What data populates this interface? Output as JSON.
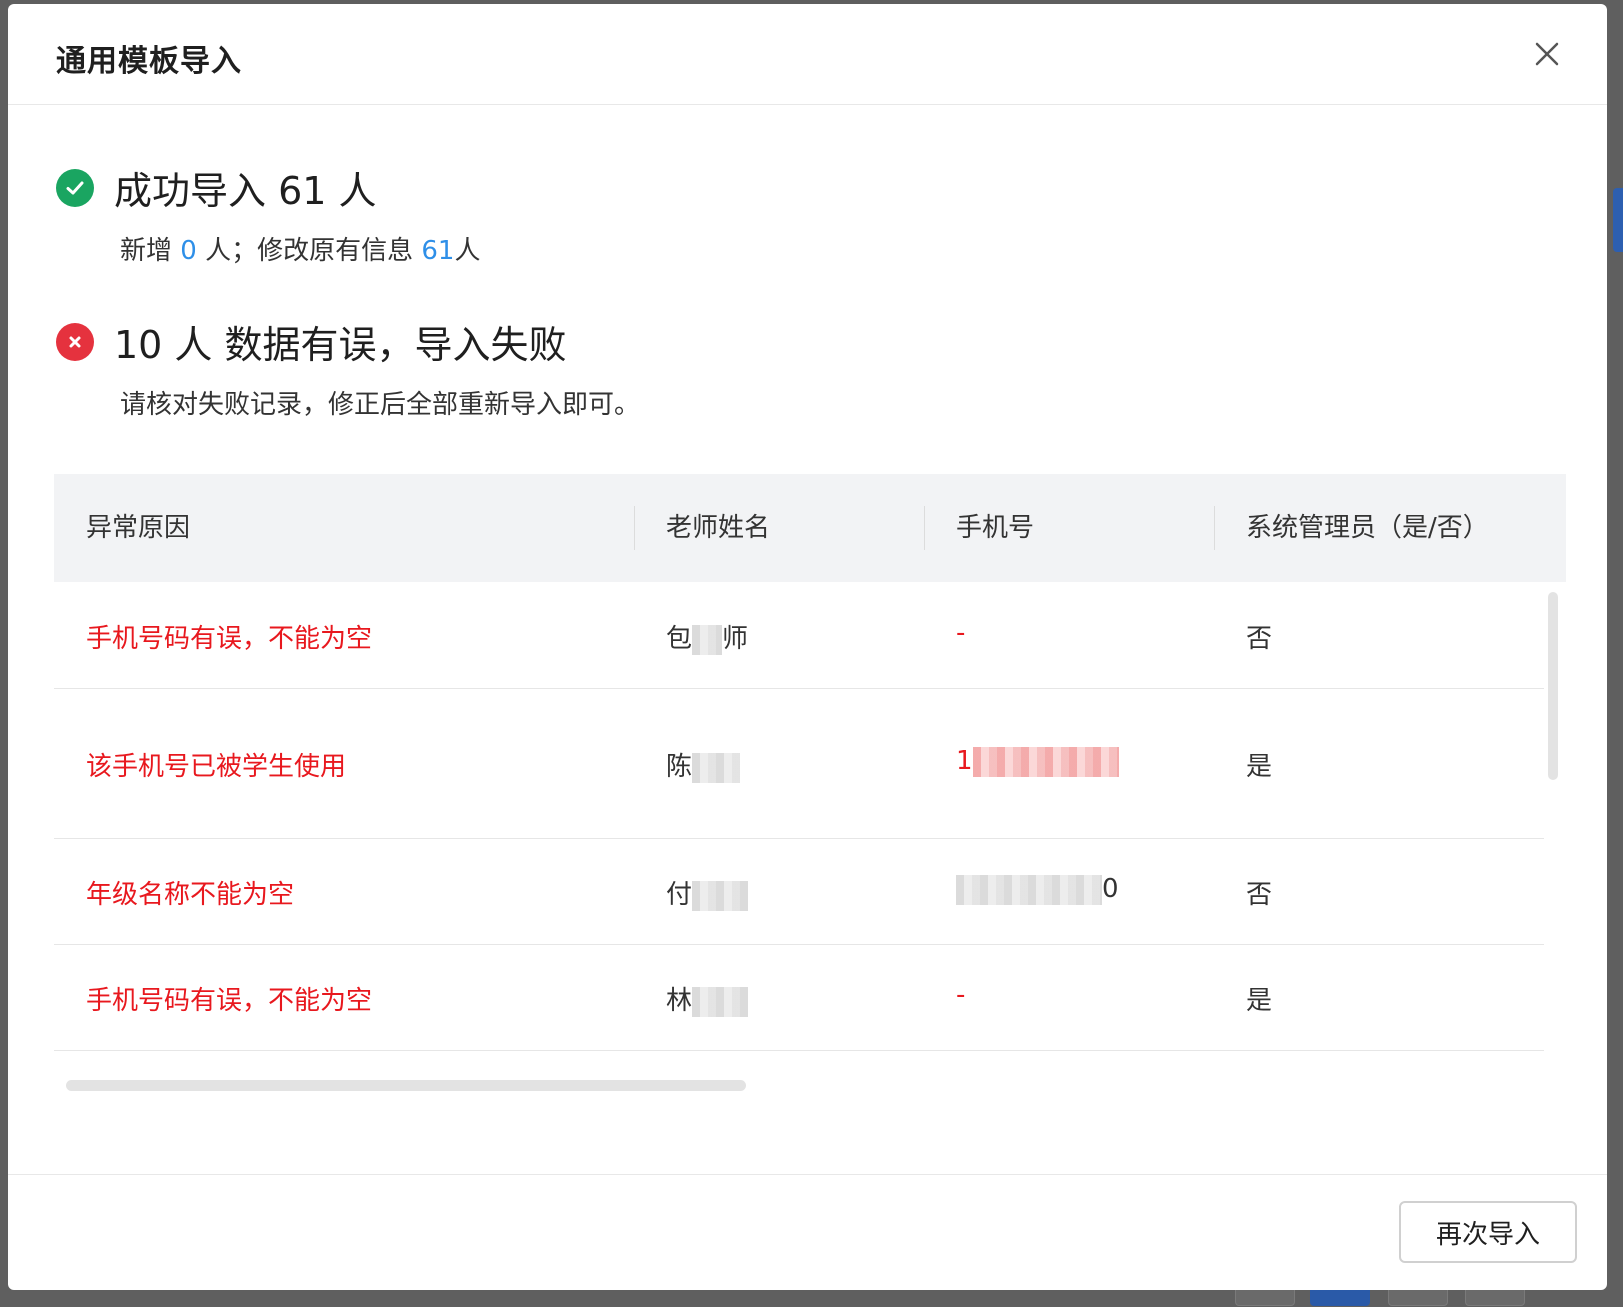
{
  "modal": {
    "title": "通用模板导入",
    "close_icon": "close-icon"
  },
  "success": {
    "icon": "check-circle-icon",
    "color": "#1aa561",
    "heading": "成功导入 61 人",
    "sub_prefix": "新增 ",
    "new_count": "0",
    "sub_mid": " 人；修改原有信息 ",
    "modified_count": "61",
    "sub_suffix": "人"
  },
  "failure": {
    "icon": "x-circle-icon",
    "color": "#e5323e",
    "heading": "10 人 数据有误，导入失败",
    "sub": "请核对失败记录，修正后全部重新导入即可。"
  },
  "table": {
    "headers": [
      "异常原因",
      "老师姓名",
      "手机号",
      "系统管理员（是/否）"
    ],
    "rows": [
      {
        "reason": "手机号码有误，不能为空",
        "name_visible": "包",
        "name_tail": "师",
        "phone": "-",
        "phone_red": true,
        "phone_masked": false,
        "admin": "否"
      },
      {
        "reason": "该手机号已被学生使用",
        "name_visible": "陈",
        "name_tail": "",
        "phone": "1",
        "phone_red": true,
        "phone_masked": true,
        "admin": "是"
      },
      {
        "reason": "年级名称不能为空",
        "name_visible": "付",
        "name_tail": "",
        "phone": "0",
        "phone_red": false,
        "phone_masked": true,
        "admin": "否"
      },
      {
        "reason": "手机号码有误，不能为空",
        "name_visible": "林",
        "name_tail": "",
        "phone": "-",
        "phone_red": true,
        "phone_masked": false,
        "admin": "是"
      }
    ]
  },
  "footer": {
    "reimport_label": "再次导入"
  },
  "colors": {
    "error_text": "#e8181e",
    "link_blue": "#2e8fe8",
    "header_bg": "#f2f3f5"
  }
}
